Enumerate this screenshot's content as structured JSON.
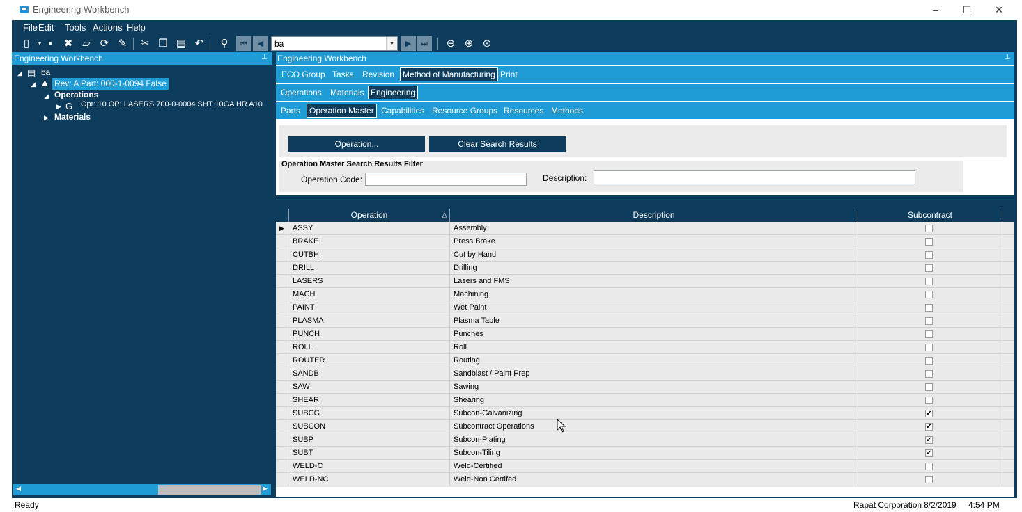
{
  "window": {
    "title": "Engineering Workbench",
    "controls": [
      "–",
      "☐",
      "✕"
    ]
  },
  "menu": [
    "File",
    "Edit",
    "Tools",
    "Actions",
    "Help"
  ],
  "toolbar": {
    "search_value": "ba"
  },
  "left_panel": {
    "title": "Engineering Workbench",
    "tree": {
      "root": "ba",
      "revision": "Rev: A Part: 000-1-0094 False",
      "operations_label": "Operations",
      "operation_item": "Opr: 10 OP: LASERS 700-0-0004  SHT 10GA HR A10",
      "materials_label": "Materials"
    }
  },
  "right_panel": {
    "title": "Engineering Workbench",
    "tabs_level1": [
      "ECO Group",
      "Tasks",
      "Revision",
      "Method of Manufacturing",
      "Print"
    ],
    "tabs_level1_active": "Method of Manufacturing",
    "tabs_level2": [
      "Operations",
      "Materials",
      "Engineering"
    ],
    "tabs_level2_active": "Engineering",
    "tabs_level3": [
      "Parts",
      "Operation Master",
      "Capabilities",
      "Resource Groups",
      "Resources",
      "Methods"
    ],
    "tabs_level3_active": "Operation Master",
    "buttons": {
      "operation": "Operation...",
      "clear": "Clear Search Results"
    },
    "filter": {
      "title": "Operation Master Search Results Filter",
      "operation_code_label": "Operation Code:",
      "operation_code_value": "",
      "description_label": "Description:",
      "description_value": ""
    },
    "grid": {
      "columns": [
        "Operation",
        "Description",
        "Subcontract"
      ],
      "rows": [
        {
          "operation": "ASSY",
          "description": "Assembly",
          "subcontract": false
        },
        {
          "operation": "BRAKE",
          "description": "Press Brake",
          "subcontract": false
        },
        {
          "operation": "CUTBH",
          "description": "Cut by Hand",
          "subcontract": false
        },
        {
          "operation": "DRILL",
          "description": "Drilling",
          "subcontract": false
        },
        {
          "operation": "LASERS",
          "description": "Lasers and FMS",
          "subcontract": false
        },
        {
          "operation": "MACH",
          "description": "Machining",
          "subcontract": false
        },
        {
          "operation": "PAINT",
          "description": "Wet Paint",
          "subcontract": false
        },
        {
          "operation": "PLASMA",
          "description": "Plasma Table",
          "subcontract": false
        },
        {
          "operation": "PUNCH",
          "description": "Punches",
          "subcontract": false
        },
        {
          "operation": "ROLL",
          "description": "Roll",
          "subcontract": false
        },
        {
          "operation": "ROUTER",
          "description": "Routing",
          "subcontract": false
        },
        {
          "operation": "SANDB",
          "description": "Sandblast / Paint Prep",
          "subcontract": false
        },
        {
          "operation": "SAW",
          "description": "Sawing",
          "subcontract": false
        },
        {
          "operation": "SHEAR",
          "description": "Shearing",
          "subcontract": false
        },
        {
          "operation": "SUBCG",
          "description": "Subcon-Galvanizing",
          "subcontract": true
        },
        {
          "operation": "SUBCON",
          "description": "Subcontract Operations",
          "subcontract": true
        },
        {
          "operation": "SUBP",
          "description": "Subcon-Plating",
          "subcontract": true
        },
        {
          "operation": "SUBT",
          "description": "Subcon-Tiling",
          "subcontract": true
        },
        {
          "operation": "WELD-C",
          "description": "Weld-Certified",
          "subcontract": false
        },
        {
          "operation": "WELD-NC",
          "description": "Weld-Non Certifed",
          "subcontract": false
        }
      ]
    }
  },
  "status": {
    "text": "Ready",
    "company": "Rapat Corporation",
    "date": "8/2/2019",
    "time": "4:54 PM"
  },
  "colors": {
    "frame": "#0e3c5c",
    "accent": "#1f9bd6",
    "grid_row": "#eaeaea"
  }
}
